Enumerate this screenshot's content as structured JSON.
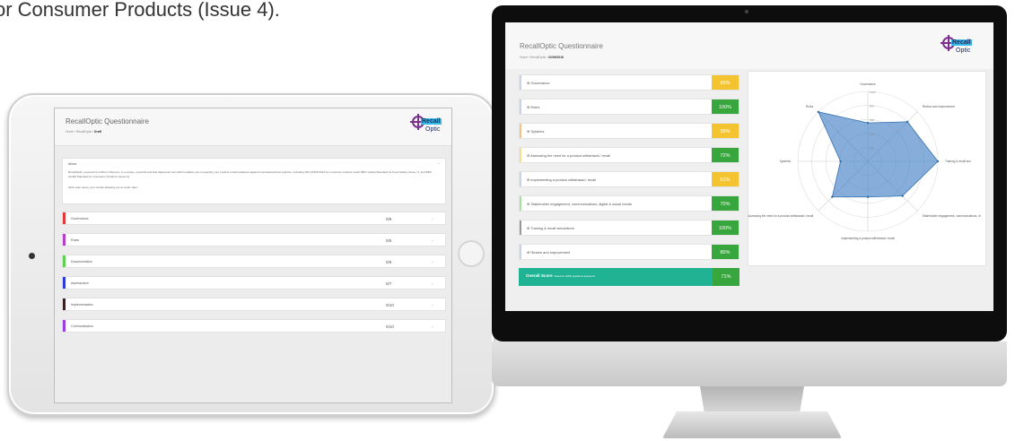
{
  "caption": "or Consumer Products (Issue 4).",
  "ipad": {
    "title": "RecallOptic Questionnaire",
    "crumb_home": "Home",
    "crumb_app": "RecallOptic",
    "crumb_current": "Draft",
    "about": {
      "title": "About",
      "caret": "^",
      "text": "RecallOptic, powered by Inkhorn Partners, is a unique, powerful and fast diagnostic tool which enables you to quantify your product recall readiness against international best practice, including ISO 10393:2013 for consumer product recall, BRC Global Standard for Food Safety (Issue 7), and BRC Global Standard for Consumer Products (Issue 3).",
      "text2": "Optic auto saves your results allowing you to return later."
    },
    "categories": [
      {
        "label": "Governance",
        "score": "0/8",
        "color": "#e23a3a"
      },
      {
        "label": "Roles",
        "score": "0/5",
        "color": "#b63ec8"
      },
      {
        "label": "Documentation",
        "score": "0/9",
        "color": "#5fd150"
      },
      {
        "label": "Assessment",
        "score": "0/7",
        "color": "#2c3cd6"
      },
      {
        "label": "Implementation",
        "score": "0/10",
        "color": "#3a2222"
      },
      {
        "label": "Communication",
        "score": "0/10",
        "color": "#9a3ee0"
      }
    ]
  },
  "imac": {
    "title": "RecallOptic Questionnaire",
    "crumb_home": "Home",
    "crumb_app": "RecallOptic",
    "crumb_current": "02/09/2016",
    "scores": [
      {
        "label": "Governance",
        "value": "55%",
        "color": "#f4c430",
        "stripe": "#c8d0f0"
      },
      {
        "label": "Roles",
        "value": "100%",
        "color": "#37a63c",
        "stripe": "#c8d0f0"
      },
      {
        "label": "Systems",
        "value": "39%",
        "color": "#f4c430",
        "stripe": "#f7c28a"
      },
      {
        "label": "Assessing the need for a product withdrawal / recall",
        "value": "72%",
        "color": "#37a63c",
        "stripe": "#f7e08a"
      },
      {
        "label": "Implementing a product withdrawal / recall",
        "value": "51%",
        "color": "#f4c430",
        "stripe": "#c8d0f0"
      },
      {
        "label": "Stakeholder engagement, communications, digital & social media",
        "value": "70%",
        "color": "#37a63c",
        "stripe": "#a8e0a0"
      },
      {
        "label": "Training & recall simulations",
        "value": "100%",
        "color": "#37a63c",
        "stripe": "#999999"
      },
      {
        "label": "Review and improvement",
        "value": "80%",
        "color": "#37a63c",
        "stripe": "#c8d0f0"
      }
    ],
    "overall": {
      "label": "Overall Score",
      "note": "based on 100% questions answered",
      "value": "71%"
    },
    "radar": {
      "axes": [
        "Governance",
        "Review and improvement",
        "Training & recall sim",
        "Stakeholder engagement, communications, di",
        "Implementing a product withdrawal / recall",
        "Accessing the need for a product withdrawal / recall",
        "Systems",
        "Roles"
      ],
      "values": [
        55,
        80,
        100,
        70,
        51,
        72,
        39,
        100
      ],
      "tick_labels": [
        "100%",
        "80%",
        "60%",
        "40%",
        "20%"
      ]
    }
  }
}
